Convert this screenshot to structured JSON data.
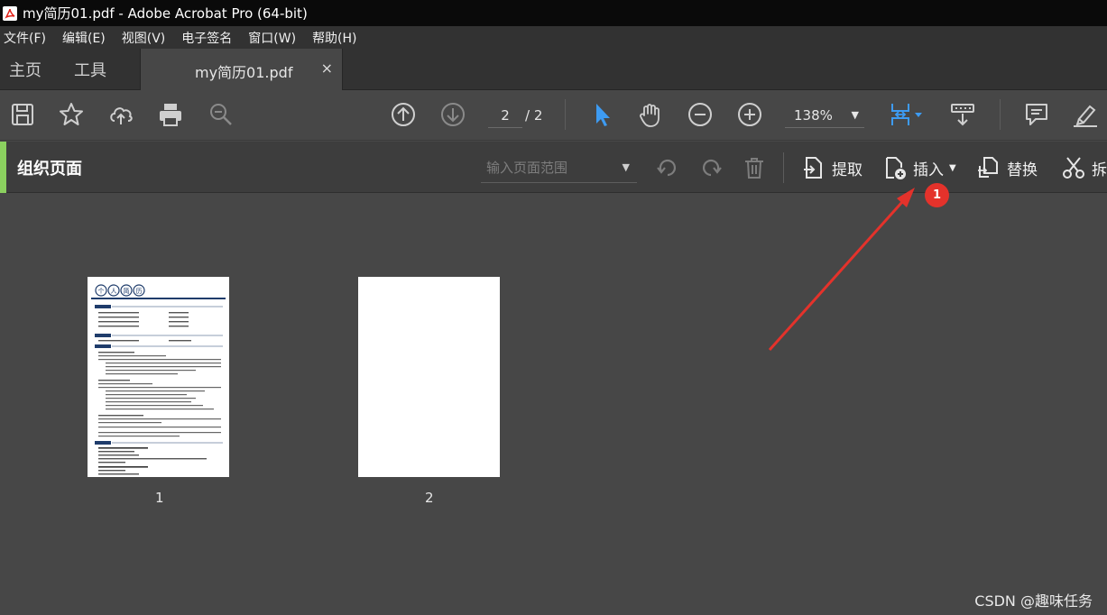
{
  "window": {
    "title": "my简历01.pdf - Adobe Acrobat Pro (64-bit)"
  },
  "menu": [
    "文件(F)",
    "编辑(E)",
    "视图(V)",
    "电子签名",
    "窗口(W)",
    "帮助(H)"
  ],
  "tabs": {
    "home": "主页",
    "tools": "工具",
    "document": "my简历01.pdf",
    "close": "×"
  },
  "toolbar": {
    "current_page": "2",
    "total_pages": "/ 2",
    "zoom": "138%",
    "icons": [
      "save-icon",
      "star-icon",
      "cloud-upload-icon",
      "print-icon",
      "search-icon",
      "page-up-icon",
      "page-down-icon",
      "select-cursor-icon",
      "hand-icon",
      "zoom-out-icon",
      "zoom-in-icon",
      "page-fit-icon",
      "scroll-mode-icon",
      "comment-icon",
      "highlight-icon"
    ]
  },
  "organize": {
    "title": "组织页面",
    "range_placeholder": "输入页面范围",
    "extract": "提取",
    "insert": "插入",
    "replace": "替换",
    "split": "拆"
  },
  "pages": [
    {
      "label": "1",
      "resume": {
        "header_chars": [
          "个",
          "人",
          "简",
          "历"
        ],
        "sections": [
          "基本信息",
          "求职意向",
          "教育背景",
          "工作经历",
          "自我评价"
        ]
      }
    },
    {
      "label": "2"
    }
  ],
  "annotation": {
    "badge": "1"
  },
  "watermark": "CSDN @趣味任务",
  "colors": {
    "accent_green": "#8bd05f",
    "selected_blue": "#3d9bf2",
    "annotation_red": "#e4322b",
    "resume_navy": "#1f3c6b"
  }
}
